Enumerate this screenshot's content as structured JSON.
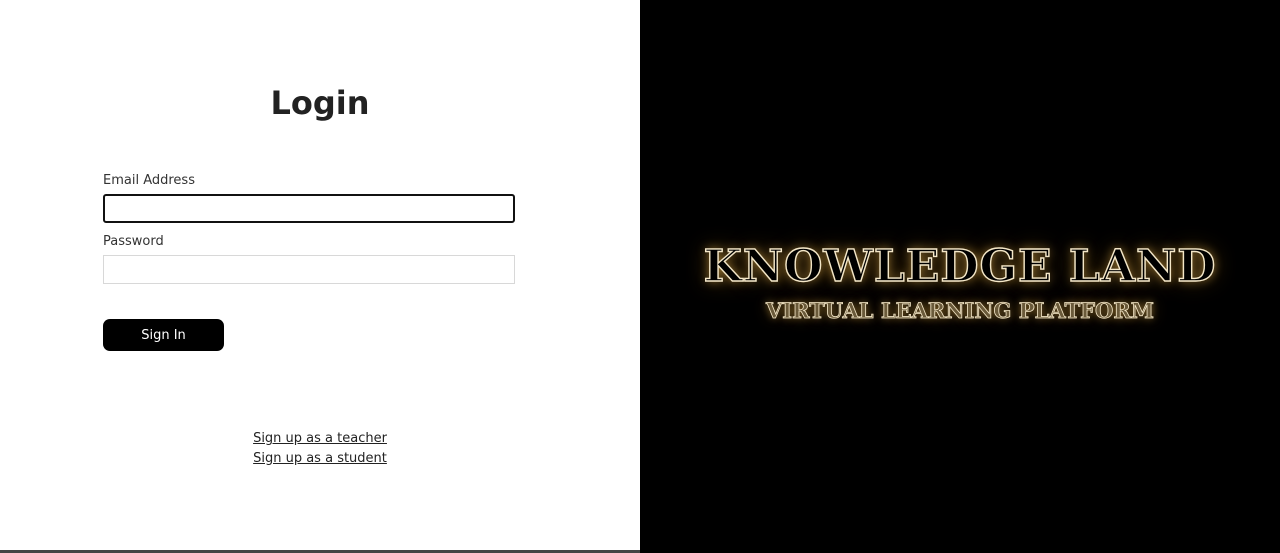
{
  "login": {
    "title": "Login",
    "email_label": "Email Address",
    "email_value": "",
    "password_label": "Password",
    "password_value": "",
    "sign_in_label": "Sign In",
    "teacher_link": "Sign up as a teacher",
    "student_link": "Sign up as a student"
  },
  "brand": {
    "title": "KNOWLEDGE LAND",
    "subtitle": "VIRTUAL LEARNING PLATFORM"
  },
  "colors": {
    "button_bg": "#000000",
    "brand_panel_bg": "#000000",
    "brand_glow": "#ffc85a"
  }
}
